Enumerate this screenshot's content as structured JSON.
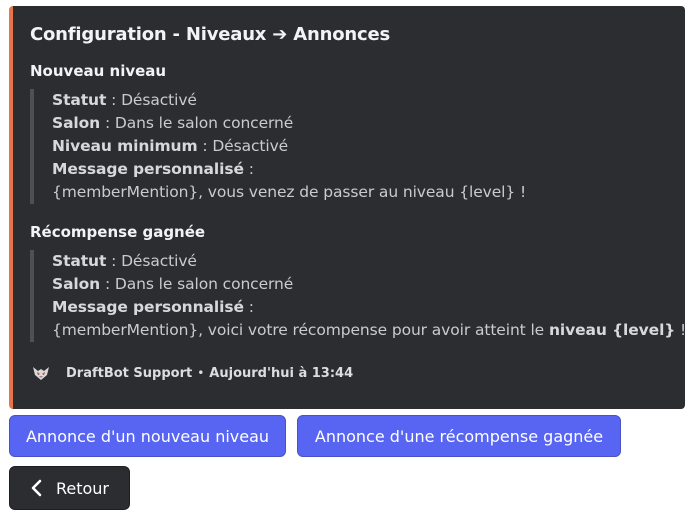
{
  "embed": {
    "accent_color": "#e8754a",
    "title": "Configuration - Niveaux ➔ Annonces",
    "sections": [
      {
        "name": "Nouveau niveau",
        "lines": [
          {
            "label": "Statut",
            "sep": " : ",
            "value": "Désactivé"
          },
          {
            "label": "Salon",
            "sep": " : ",
            "value": "Dans le salon concerné"
          },
          {
            "label": "Niveau minimum",
            "sep": " : ",
            "value": "Désactivé"
          },
          {
            "label": "Message personnalisé",
            "sep": " :",
            "value": ""
          }
        ],
        "message": {
          "text": "{memberMention}, vous venez de passer au niveau {level} !"
        }
      },
      {
        "name": "Récompense gagnée",
        "lines": [
          {
            "label": "Statut",
            "sep": " : ",
            "value": "Désactivé"
          },
          {
            "label": "Salon",
            "sep": " : ",
            "value": "Dans le salon concerné"
          },
          {
            "label": "Message personnalisé",
            "sep": " :",
            "value": ""
          }
        ],
        "message": {
          "text": "{memberMention}, voici votre récompense pour avoir atteint le ",
          "bold": "niveau {level}",
          "suffix": " !"
        }
      }
    ],
    "footer": {
      "author": "DraftBot Support",
      "separator": "•",
      "timestamp": "Aujourd'hui à 13:44",
      "avatar_icon": "draftbot-logo-icon"
    }
  },
  "buttons": {
    "new_level": "Annonce d'un nouveau niveau",
    "reward": "Annonce d'une récompense gagnée",
    "back": "Retour",
    "back_icon": "chevron-left-icon",
    "primary_color": "#5865f2",
    "secondary_color": "#2b2d31"
  }
}
